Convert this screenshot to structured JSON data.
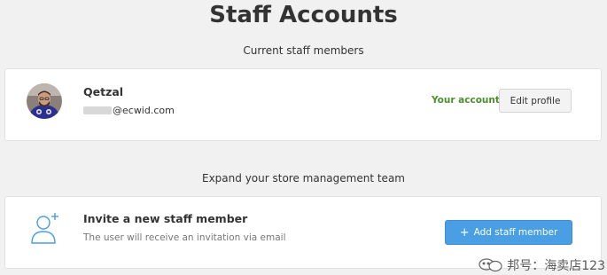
{
  "page": {
    "title": "Staff Accounts"
  },
  "current_staff": {
    "heading": "Current staff members",
    "member": {
      "name": "Qetzal",
      "email_suffix": "@ecwid.com",
      "badge": "Your account",
      "edit_label": "Edit profile",
      "avatar_icon": "user-avatar-photo"
    }
  },
  "expand_team": {
    "heading": "Expand your store management team",
    "invite_title": "Invite a new staff member",
    "invite_description": "The user will receive an invitation via email",
    "add_button_label": "Add staff member",
    "add_icon": "plus-icon",
    "invite_icon": "add-user-icon"
  },
  "watermark": {
    "text": "邦号：海卖店123",
    "icon": "chat-bubbles-icon"
  },
  "colors": {
    "accent_blue": "#4a9ee3",
    "your_account_green": "#4d8e2c",
    "background": "#f1f1f1"
  }
}
